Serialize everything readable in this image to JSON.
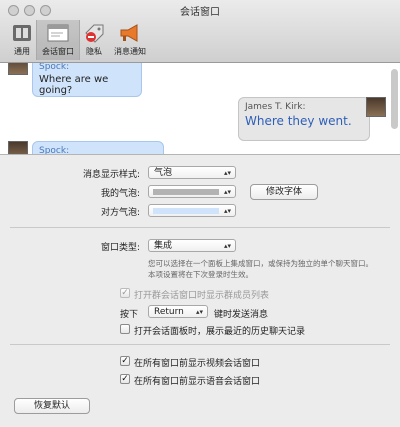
{
  "window": {
    "title": "会话窗口"
  },
  "toolbar": [
    {
      "label": "通用",
      "icon": "switch-icon"
    },
    {
      "label": "会话窗口",
      "icon": "chat-window-icon"
    },
    {
      "label": "隐私",
      "icon": "privacy-tag-icon"
    },
    {
      "label": "消息通知",
      "icon": "megaphone-icon"
    }
  ],
  "preview": {
    "messages": [
      {
        "sender": "Spock:",
        "text": "Where are we going?"
      },
      {
        "sender": "James T. Kirk:",
        "text": "Where they went."
      },
      {
        "sender": "Spock:",
        "text": ""
      }
    ]
  },
  "settings": {
    "bubble_style_label": "消息显示样式:",
    "bubble_style_value": "气泡",
    "my_bubble_label": "我的气泡:",
    "their_bubble_label": "对方气泡:",
    "change_font_label": "修改字体",
    "window_type_label": "窗口类型:",
    "window_type_value": "集成",
    "window_type_note": "您可以选择在一个面板上集成窗口，或保持为独立的单个聊天窗口。本项设置将在下次登录时生效。",
    "group_members_label": "打开群会话窗口时显示群成员列表",
    "press_label": "按下",
    "send_key_value": "Return",
    "send_suffix": "键时发送消息",
    "history_label": "打开会话面板时，展示最近的历史聊天记录",
    "video_front_label": "在所有窗口前显示视频会话窗口",
    "voice_front_label": "在所有窗口前显示语音会话窗口",
    "restore_label": "恢复默认"
  },
  "colors": {
    "my_bubble": "#b3b3b3",
    "their_bubble": "#cfe3fb",
    "spock_name": "#4a78b8",
    "kirk_text": "#2e5fb8"
  }
}
